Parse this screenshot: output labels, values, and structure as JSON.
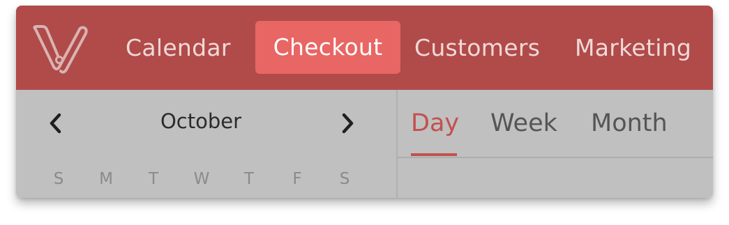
{
  "colors": {
    "topbar": "#b04b4a",
    "active_nav": "#e86663",
    "accent": "#c2504f",
    "panel": "#c0c0c0"
  },
  "topbar": {
    "logo_icon": "v-logo-icon",
    "nav": [
      {
        "label": "Calendar",
        "active": false
      },
      {
        "label": "Checkout",
        "active": true
      },
      {
        "label": "Customers",
        "active": false
      },
      {
        "label": "Marketing",
        "active": false
      }
    ]
  },
  "minical": {
    "prev_icon": "chevron-left-icon",
    "next_icon": "chevron-right-icon",
    "month": "October",
    "weekdays": [
      "S",
      "M",
      "T",
      "W",
      "T",
      "F",
      "S"
    ]
  },
  "views": {
    "tabs": [
      {
        "label": "Day",
        "active": true
      },
      {
        "label": "Week",
        "active": false
      },
      {
        "label": "Month",
        "active": false
      }
    ]
  }
}
